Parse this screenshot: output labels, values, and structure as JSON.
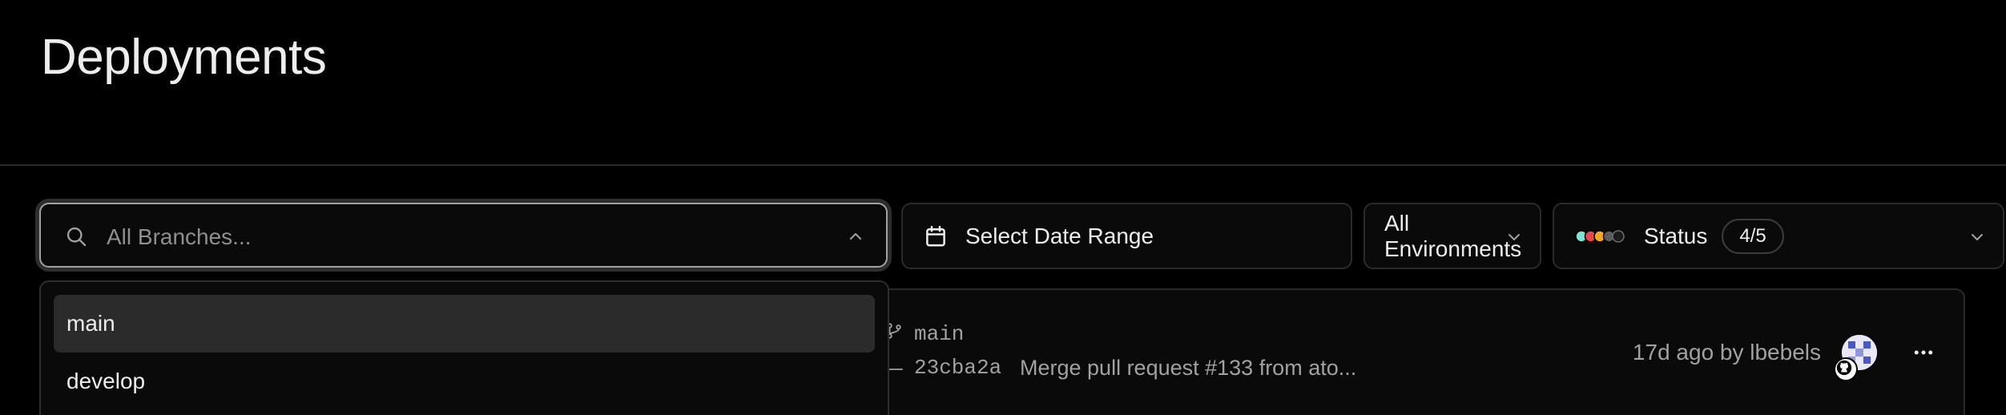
{
  "page": {
    "title": "Deployments"
  },
  "filters": {
    "branch_search": {
      "placeholder": "All Branches...",
      "value": ""
    },
    "date_range": {
      "label": "Select Date Range"
    },
    "environment": {
      "label": "All Environments"
    },
    "status": {
      "label": "Status",
      "count": "4/5",
      "dot_colors": [
        "#7fe3d2",
        "#e5484d",
        "#f5a623",
        "#5c5c5c",
        "#1a1a1a"
      ]
    }
  },
  "branch_dropdown": {
    "items": [
      {
        "label": "main",
        "selected": true
      },
      {
        "label": "develop",
        "selected": false
      }
    ]
  },
  "deployments": [
    {
      "branch": "main",
      "commit_hash": "23cba2a",
      "commit_message": "Merge pull request #133 from ato...",
      "meta": "17d ago by lbebels"
    }
  ],
  "icons": {
    "search": "search-icon",
    "chevron_up": "chevron-up-icon",
    "calendar": "calendar-icon",
    "chevron_down": "chevron-down-icon",
    "branch": "git-branch-icon",
    "commit": "git-commit-icon",
    "github": "github-icon",
    "more": "more-horizontal-icon"
  }
}
